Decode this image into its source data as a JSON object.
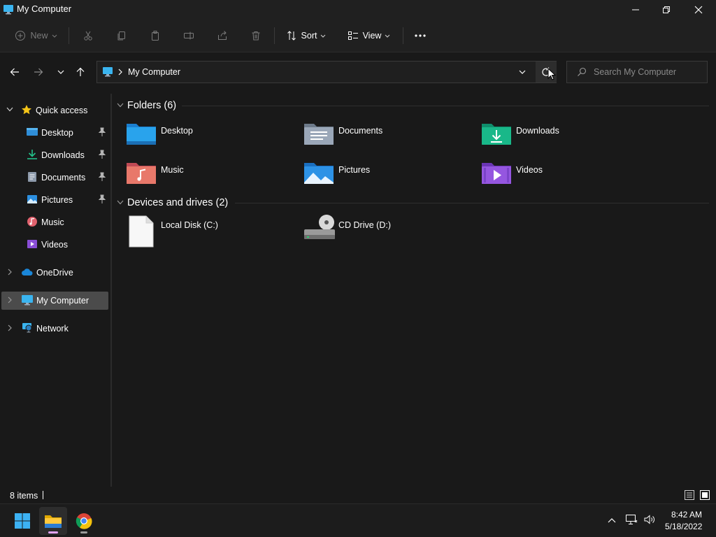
{
  "window": {
    "title": "My Computer"
  },
  "toolbar": {
    "new_label": "New",
    "sort_label": "Sort",
    "view_label": "View"
  },
  "address": {
    "path": "My Computer",
    "search_placeholder": "Search My Computer"
  },
  "sidebar": {
    "quick_access": "Quick access",
    "items": [
      {
        "label": "Desktop",
        "pinned": true
      },
      {
        "label": "Downloads",
        "pinned": true
      },
      {
        "label": "Documents",
        "pinned": true
      },
      {
        "label": "Pictures",
        "pinned": true
      },
      {
        "label": "Music",
        "pinned": false
      },
      {
        "label": "Videos",
        "pinned": false
      }
    ],
    "onedrive": "OneDrive",
    "my_computer": "My Computer",
    "network": "Network"
  },
  "content": {
    "folders_header": "Folders (6)",
    "folders": [
      "Desktop",
      "Documents",
      "Downloads",
      "Music",
      "Pictures",
      "Videos"
    ],
    "drives_header": "Devices and drives (2)",
    "drives": [
      "Local Disk (C:)",
      "CD Drive (D:)"
    ]
  },
  "status": {
    "items": "8 items"
  },
  "taskbar": {
    "time": "8:42 AM",
    "date": "5/18/2022"
  },
  "colors": {
    "background": "#191919",
    "chrome": "#202020",
    "accent_blue": "#1aa0e6",
    "selected": "#4b4b4b"
  }
}
